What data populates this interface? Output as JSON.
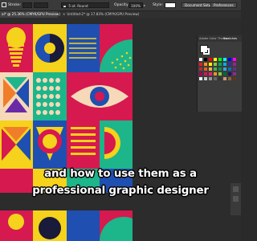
{
  "control_bar": {
    "stroke_label": "Stroke:",
    "brush_value": "5 pt. Round",
    "opacity_label": "Opacity:",
    "opacity_value": "100%",
    "style_label": "Style:",
    "document_setup_label": "Document Setup",
    "preferences_label": "Preferences"
  },
  "tabs": [
    {
      "label": "ai* @ 25.36% (CMYK/GPU Preview)",
      "active": true
    },
    {
      "label": "Untitled-2* @ 17.83% (CMYK/GPU Preview)",
      "active": false
    }
  ],
  "panel": {
    "tab_color_themes": "Adobe Color Theme",
    "tab_swatches": "Swatches"
  },
  "subtitle": {
    "line1": "and how to use them as a",
    "line2": "professional graphic designer"
  },
  "colors": {
    "crimson": "#d6194f",
    "yellow": "#f5d21b",
    "blue": "#1f4fb0",
    "green": "#1db58a",
    "cream": "#f6d9b8",
    "orange": "#f07d2a",
    "purple": "#6a2aa8",
    "panel_bg": "#3c3c3c",
    "ui_dark": "#2c2c2c"
  },
  "swatches": [
    "#ffffff",
    "#000000",
    "#ff0000",
    "#ffff00",
    "#00ff00",
    "#00ffff",
    "#0000ff",
    "#ff00ff",
    "#ed1c24",
    "#f7941d",
    "#fff200",
    "#8dc63f",
    "#00a651",
    "#00aeef",
    "#2e3192",
    "#92278f",
    "#c1272d",
    "#f15a24",
    "#fbb03b",
    "#39b54a",
    "#009245",
    "#29abe2",
    "#0071bc",
    "#662d91",
    "#9e005d",
    "#d4145a",
    "#ed1e79",
    "#f7931e",
    "#8cc63f",
    "#006837",
    "#1b1464",
    "#93278f",
    "#f2f2f2",
    "#cccccc",
    "#999999",
    "#666666",
    "#333333",
    "#c69c6d",
    "#8c6239",
    "#603813"
  ]
}
